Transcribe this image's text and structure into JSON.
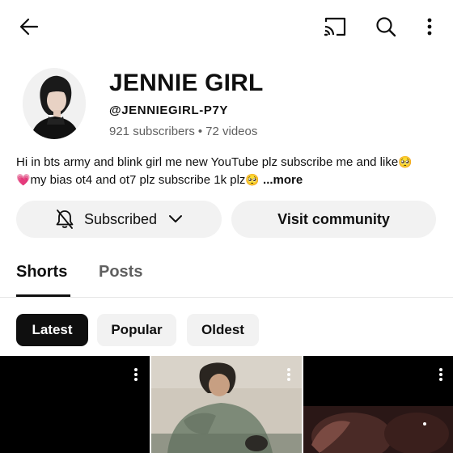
{
  "topbar": {
    "back_icon": "arrow-left-icon",
    "cast_icon": "cast-icon",
    "search_icon": "search-icon",
    "more_icon": "more-vertical-icon"
  },
  "channel": {
    "name": "JENNIE GIRL",
    "handle": "@JENNIEGIRL-P7Y",
    "subscribers": "921 subscribers",
    "separator": "•",
    "videos": "72 videos",
    "description_line1": "Hi in bts army and blink girl me new YouTube plz subscribe me and like",
    "description_line2_a": "my bias ot4 and ot7 plz subscribe 1k plz",
    "description_more": "...more",
    "emoji_pleading": "🥺",
    "emoji_heart": "💗"
  },
  "actions": {
    "subscribed_label": "Subscribed",
    "bell_icon": "bell-off-icon",
    "chevron_icon": "chevron-down-icon",
    "community_label": "Visit community"
  },
  "tabs": [
    {
      "label": "Shorts",
      "selected": true
    },
    {
      "label": "Posts",
      "selected": false
    }
  ],
  "filters": [
    {
      "label": "Latest",
      "selected": true
    },
    {
      "label": "Popular",
      "selected": false
    },
    {
      "label": "Oldest",
      "selected": false
    }
  ],
  "colors": {
    "text_primary": "#0f0f0f",
    "text_secondary": "#606060",
    "chip_bg": "#f2f2f2",
    "chip_selected_bg": "#0f0f0f"
  }
}
